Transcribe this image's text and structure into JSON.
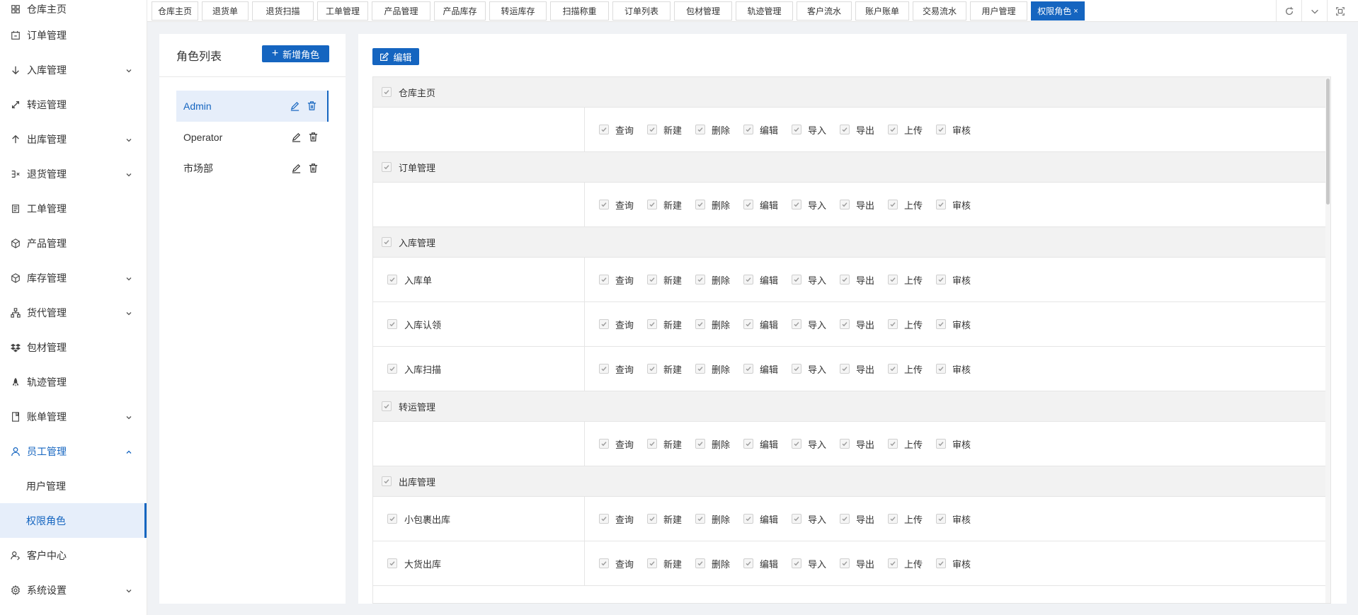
{
  "sidebar": {
    "items": [
      {
        "label": "仓库主页",
        "icon": "dashboard-icon",
        "expandable": false
      },
      {
        "label": "订单管理",
        "icon": "order-icon",
        "expandable": false
      },
      {
        "label": "入库管理",
        "icon": "arrow-down-icon",
        "expandable": true
      },
      {
        "label": "转运管理",
        "icon": "transfer-icon",
        "expandable": false
      },
      {
        "label": "出库管理",
        "icon": "arrow-up-icon",
        "expandable": true
      },
      {
        "label": "退货管理",
        "icon": "return-icon",
        "expandable": true
      },
      {
        "label": "工单管理",
        "icon": "ticket-icon",
        "expandable": false
      },
      {
        "label": "产品管理",
        "icon": "product-icon",
        "expandable": false
      },
      {
        "label": "库存管理",
        "icon": "box-icon",
        "expandable": true
      },
      {
        "label": "货代管理",
        "icon": "network-icon",
        "expandable": true
      },
      {
        "label": "包材管理",
        "icon": "package-icon",
        "expandable": false
      },
      {
        "label": "轨迹管理",
        "icon": "rocket-icon",
        "expandable": false
      },
      {
        "label": "账单管理",
        "icon": "bill-icon",
        "expandable": true
      },
      {
        "label": "员工管理",
        "icon": "user-icon",
        "expandable": true,
        "expanded": true
      },
      {
        "label": "用户管理",
        "sub": true
      },
      {
        "label": "权限角色",
        "sub": true,
        "selected": true
      },
      {
        "label": "客户中心",
        "icon": "customer-icon",
        "expandable": false
      },
      {
        "label": "系统设置",
        "icon": "gear-icon",
        "expandable": true
      }
    ]
  },
  "tabs": [
    {
      "label": "仓库主页"
    },
    {
      "label": "退货单"
    },
    {
      "label": "退货扫描"
    },
    {
      "label": "工单管理"
    },
    {
      "label": "产品管理"
    },
    {
      "label": "产品库存"
    },
    {
      "label": "转运库存"
    },
    {
      "label": "扫描称重"
    },
    {
      "label": "订单列表"
    },
    {
      "label": "包材管理"
    },
    {
      "label": "轨迹管理"
    },
    {
      "label": "客户流水"
    },
    {
      "label": "账户账单"
    },
    {
      "label": "交易流水"
    },
    {
      "label": "用户管理"
    },
    {
      "label": "权限角色",
      "active": true,
      "close": "×"
    }
  ],
  "role_panel": {
    "title": "角色列表",
    "add_button": "新增角色",
    "add_icon": "+",
    "roles": [
      {
        "name": "Admin",
        "active": true
      },
      {
        "name": "Operator"
      },
      {
        "name": "市场部"
      }
    ]
  },
  "perm_panel": {
    "edit_button": "编辑",
    "permissions": [
      "查询",
      "新建",
      "删除",
      "编辑",
      "导入",
      "导出",
      "上传",
      "审核"
    ],
    "rows": [
      {
        "type": "module",
        "label": "仓库主页"
      },
      {
        "type": "perm",
        "label": ""
      },
      {
        "type": "module",
        "label": "订单管理"
      },
      {
        "type": "perm",
        "label": ""
      },
      {
        "type": "module",
        "label": "入库管理"
      },
      {
        "type": "perm",
        "label": "入库单"
      },
      {
        "type": "perm",
        "label": "入库认领"
      },
      {
        "type": "perm",
        "label": "入库扫描"
      },
      {
        "type": "module",
        "label": "转运管理"
      },
      {
        "type": "perm",
        "label": ""
      },
      {
        "type": "module",
        "label": "出库管理"
      },
      {
        "type": "perm",
        "label": "小包裹出库"
      },
      {
        "type": "perm",
        "label": "大货出库"
      }
    ]
  },
  "colors": {
    "primary": "#1565c0",
    "selected_bg": "#e6eefa",
    "module_bg": "#f2f2f2"
  }
}
